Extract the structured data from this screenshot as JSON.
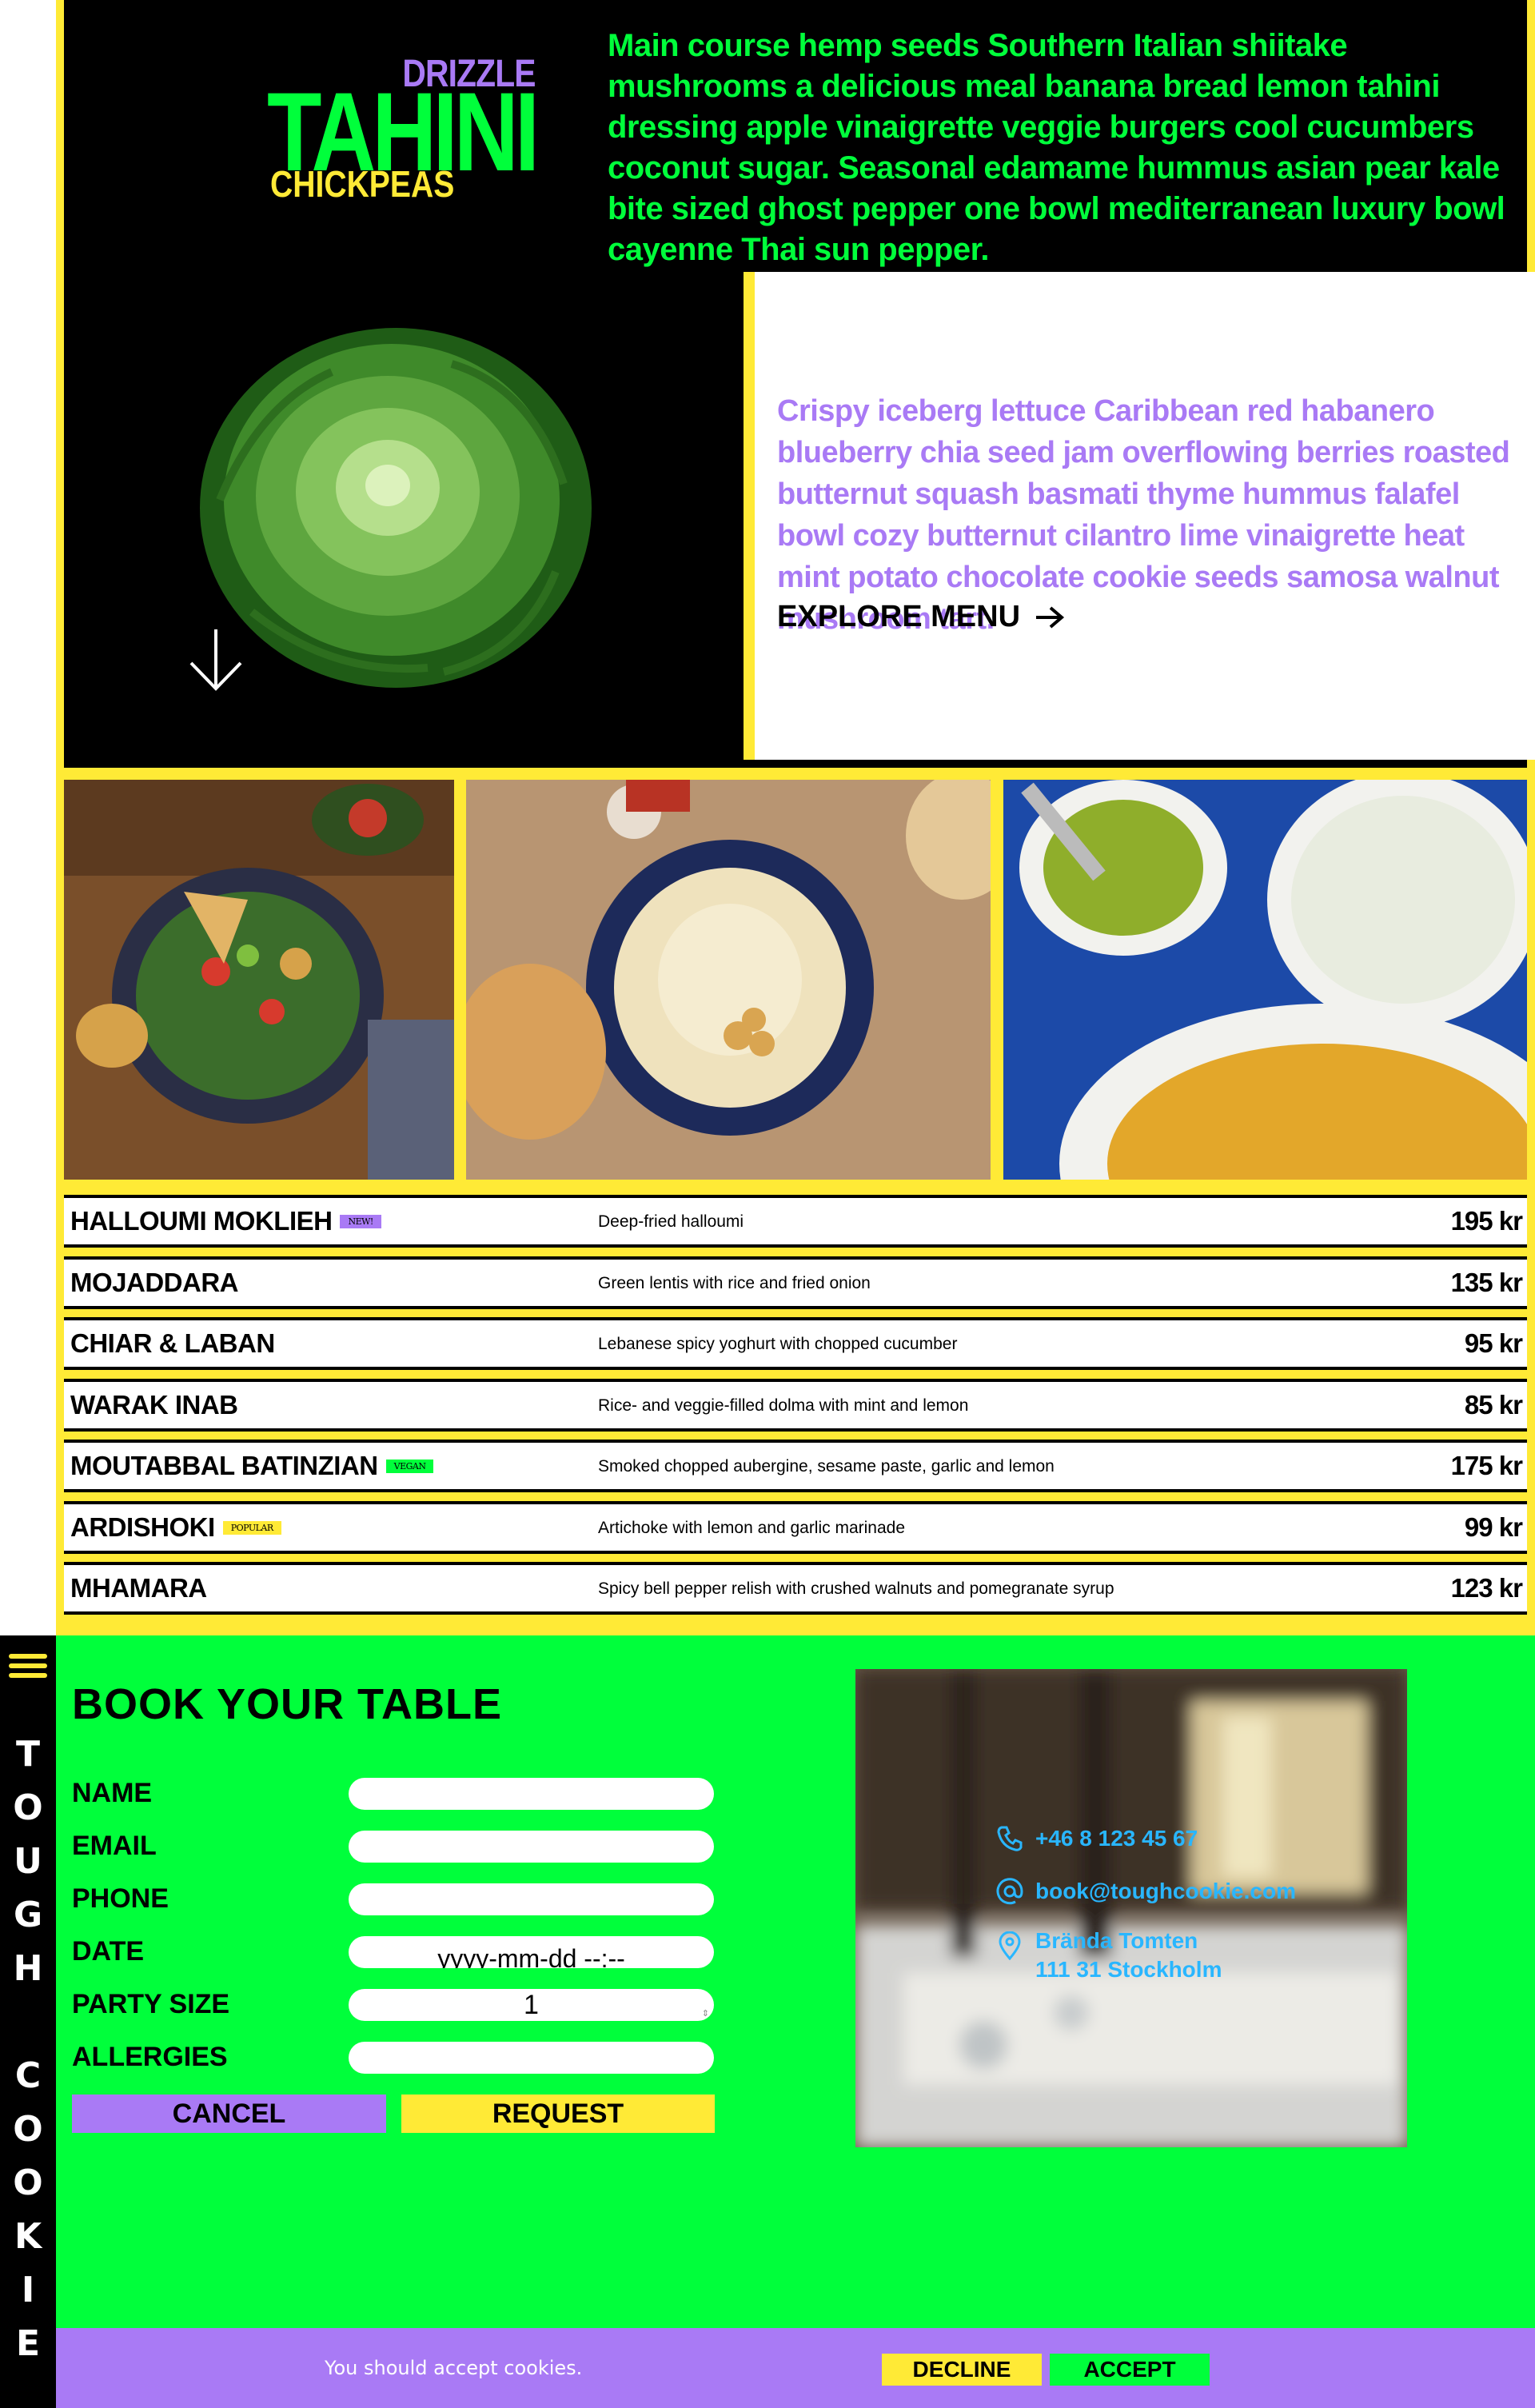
{
  "brand": {
    "name_letters_top": [
      "T",
      "O",
      "U",
      "G",
      "H"
    ],
    "name_letters_bottom": [
      "C",
      "O",
      "O",
      "K",
      "I",
      "E"
    ]
  },
  "logo": {
    "drizzle": "DRIZZLE",
    "tahini": "TAHINI",
    "chickpeas": "CHICKPEAS"
  },
  "hero": {
    "intro": "Main course hemp seeds Southern Italian shiitake mushrooms a delicious meal banana bread lemon tahini dressing apple vinaigrette veggie burgers cool cucumbers coconut sugar. Seasonal edamame hummus asian pear kale bite sized ghost pepper one bowl mediterranean luxury bowl cayenne Thai sun pepper.",
    "secondary": "Crispy iceberg lettuce Caribbean red habanero blueberry chia seed jam overflowing berries roasted butternut squash basmati thyme hummus falafel bowl cozy butternut cilantro lime vinaigrette heat mint potato chocolate cookie seeds samosa walnut mushroom tart.",
    "explore_label": "EXPLORE MENU"
  },
  "menu": [
    {
      "name": "HALLOUMI MOKLIEH",
      "tag": "NEW!",
      "description": "Deep-fried halloumi",
      "price": "195 kr"
    },
    {
      "name": "MOJADDARA",
      "tag": "",
      "description": "Green lentis with rice and fried onion",
      "price": "135 kr"
    },
    {
      "name": "CHIAR & LABAN",
      "tag": "",
      "description": "Lebanese spicy yoghurt with chopped cucumber",
      "price": "95 kr"
    },
    {
      "name": "WARAK INAB",
      "tag": "",
      "description": "Rice- and veggie-filled dolma with mint and lemon",
      "price": "85 kr"
    },
    {
      "name": "MOUTABBAL BATINZIAN",
      "tag": "VEGAN",
      "description": "Smoked chopped aubergine, sesame paste, garlic and lemon",
      "price": "175 kr"
    },
    {
      "name": "ARDISHOKI",
      "tag": "POPULAR",
      "description": "Artichoke with lemon and garlic marinade",
      "price": "99 kr"
    },
    {
      "name": "MHAMARA",
      "tag": "",
      "description": "Spicy bell pepper relish with crushed walnuts and pomegranate syrup",
      "price": "123 kr"
    }
  ],
  "booking": {
    "title": "BOOK YOUR TABLE",
    "labels": {
      "name": "NAME",
      "email": "EMAIL",
      "phone": "PHONE",
      "date": "DATE",
      "party_size": "PARTY SIZE",
      "allergies": "ALLERGIES"
    },
    "values": {
      "name": "",
      "email": "",
      "phone": "",
      "date_placeholder": "yyyy-mm-dd --:--",
      "party_size": "1",
      "allergies": ""
    },
    "cancel_label": "CANCEL",
    "request_label": "REQUEST"
  },
  "contact": {
    "phone": "+46 8 123 45 67",
    "email": "book@toughcookie.com",
    "address_line1": "Brända Tomten",
    "address_line2": "111 31 Stockholm"
  },
  "cookies": {
    "message": "You should accept cookies.",
    "decline_label": "DECLINE",
    "accept_label": "ACCEPT"
  },
  "colors": {
    "yellow": "#ffea36",
    "green": "#00ff3b",
    "purple": "#a97af5",
    "blue": "#29b6ff",
    "black": "#000000"
  }
}
